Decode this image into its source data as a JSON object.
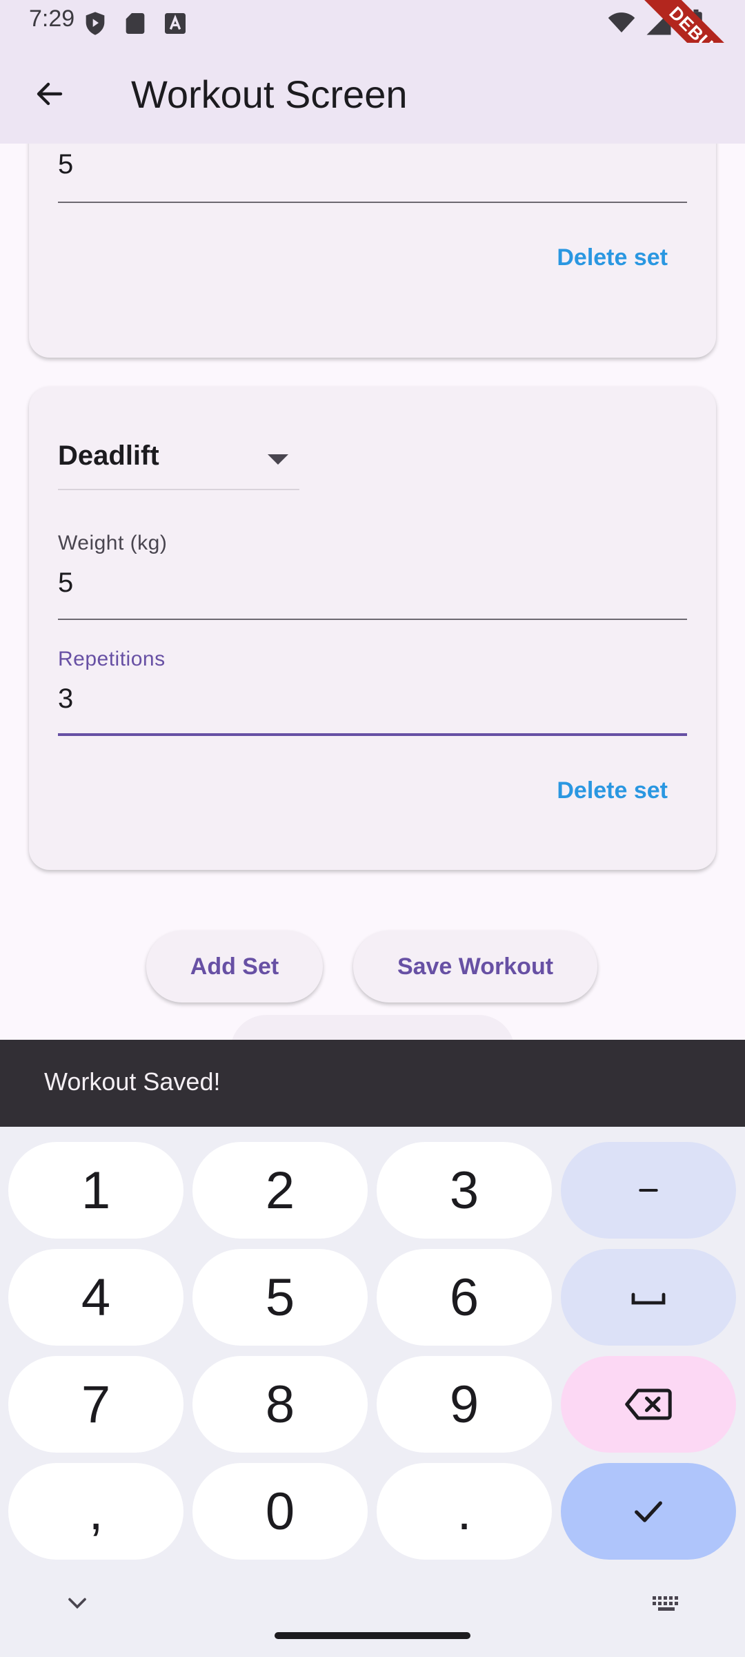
{
  "status_bar": {
    "time": "7:29",
    "icons_left": [
      "shield-play-icon",
      "sd-card-icon",
      "font-a-icon"
    ],
    "icons_right": [
      "wifi-icon",
      "signal-icon",
      "battery-icon"
    ]
  },
  "debug_banner": "DEBUG",
  "app_bar": {
    "title": "Workout Screen",
    "back_icon": "arrow-back-icon"
  },
  "sets": [
    {
      "weight_value": "5",
      "delete_label": "Delete set"
    },
    {
      "exercise": "Deadlift",
      "weight_label": "Weight (kg)",
      "weight_value": "5",
      "reps_label": "Repetitions",
      "reps_value": "3",
      "delete_label": "Delete set"
    }
  ],
  "actions": {
    "add_set": "Add Set",
    "save_workout": "Save Workout"
  },
  "snackbar": {
    "message": "Workout Saved!"
  },
  "keyboard": {
    "rows": [
      [
        "1",
        "2",
        "3",
        "–"
      ],
      [
        "4",
        "5",
        "6",
        "␣"
      ],
      [
        "7",
        "8",
        "9",
        "⌫"
      ],
      [
        ",",
        "0",
        ".",
        "✓"
      ]
    ]
  },
  "colors": {
    "accent": "#6750A4",
    "delete_text": "#2A97E1",
    "snackbar_bg": "#322F35",
    "debug_banner": "#B3261E"
  }
}
